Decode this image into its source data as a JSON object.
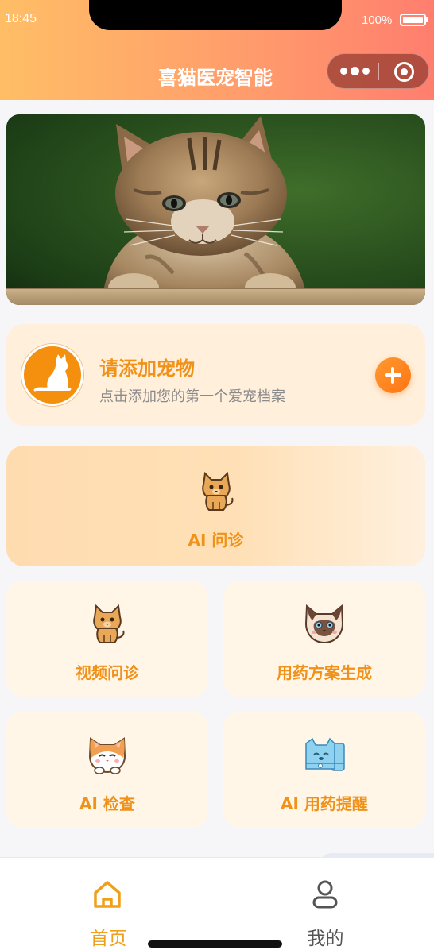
{
  "status_bar": {
    "time": "18:45",
    "battery": "100%"
  },
  "header": {
    "title": "喜猫医宠智能"
  },
  "pet_card": {
    "title": "请添加宠物",
    "subtitle": "点击添加您的第一个爱宠档案"
  },
  "features": {
    "ai_consult": "AI 问诊",
    "video_consult": "视频问诊",
    "medication_plan": "用药方案生成",
    "ai_check": "AI 检查",
    "ai_reminder": "AI 用药提醒"
  },
  "tabbar": {
    "home": "首页",
    "mine": "我的"
  },
  "colors": {
    "accent": "#f0921a",
    "header_gradient_start": "#ffbe66",
    "header_gradient_end": "#ff7e6e",
    "inactive_tab": "#555555"
  }
}
